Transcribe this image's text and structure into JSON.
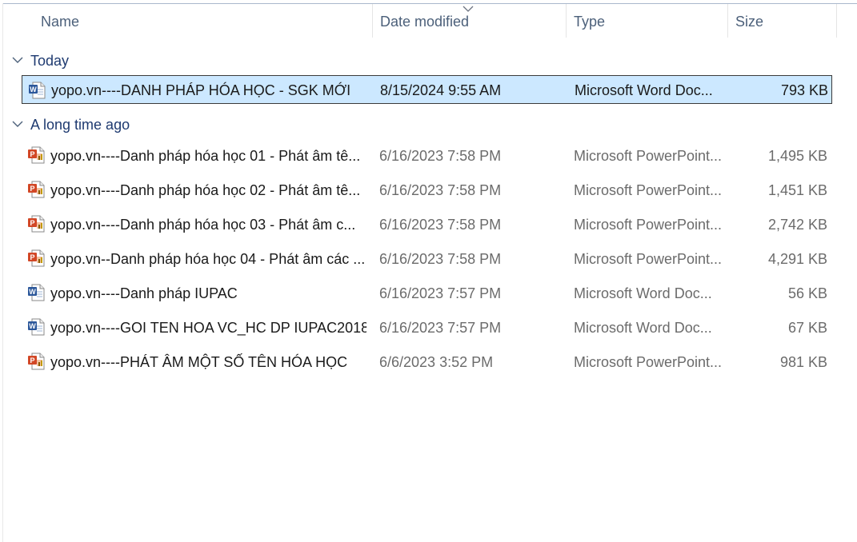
{
  "columns": {
    "name": "Name",
    "date": "Date modified",
    "type": "Type",
    "size": "Size",
    "sort_icon": "chevron-down-icon"
  },
  "colors": {
    "selection_bg": "#cce8ff",
    "group_text": "#1e3a70",
    "header_text": "#4c607a",
    "word_icon": "#2b579a",
    "ppt_icon": "#d24726"
  },
  "groups": [
    {
      "label": "Today",
      "icon": "chevron-down-icon",
      "files": [
        {
          "icon": "word-doc-icon",
          "name": "yopo.vn----DANH PHÁP HÓA HỌC - SGK MỚI",
          "date": "8/15/2024 9:55 AM",
          "type": "Microsoft Word Doc...",
          "size": "793 KB",
          "selected": true
        }
      ]
    },
    {
      "label": "A long time ago",
      "icon": "chevron-down-icon",
      "files": [
        {
          "icon": "powerpoint-icon",
          "name": "yopo.vn----Danh pháp hóa học 01 - Phát âm tê...",
          "date": "6/16/2023 7:58 PM",
          "type": "Microsoft PowerPoint...",
          "size": "1,495 KB"
        },
        {
          "icon": "powerpoint-icon",
          "name": "yopo.vn----Danh pháp hóa học 02 - Phát âm tê...",
          "date": "6/16/2023 7:58 PM",
          "type": "Microsoft PowerPoint...",
          "size": "1,451 KB"
        },
        {
          "icon": "powerpoint-icon",
          "name": "yopo.vn----Danh pháp hóa học 03 - Phát âm c...",
          "date": "6/16/2023 7:58 PM",
          "type": "Microsoft PowerPoint...",
          "size": "2,742 KB"
        },
        {
          "icon": "powerpoint-icon",
          "name": "yopo.vn--Danh pháp hóa học 04 - Phát âm các ...",
          "date": "6/16/2023 7:58 PM",
          "type": "Microsoft PowerPoint...",
          "size": "4,291 KB"
        },
        {
          "icon": "word-doc-icon",
          "name": "yopo.vn----Danh pháp IUPAC",
          "date": "6/16/2023 7:57 PM",
          "type": "Microsoft Word Doc...",
          "size": "56 KB"
        },
        {
          "icon": "word-doc-icon",
          "name": "yopo.vn----GOI TEN HOA VC_HC DP IUPAC2018.",
          "date": "6/16/2023 7:57 PM",
          "type": "Microsoft Word Doc...",
          "size": "67 KB"
        },
        {
          "icon": "powerpoint-icon",
          "name": "yopo.vn----PHÁT ÂM MỘT SỐ TÊN HÓA HỌC",
          "date": "6/6/2023 3:52 PM",
          "type": "Microsoft PowerPoint...",
          "size": "981 KB"
        }
      ]
    }
  ]
}
